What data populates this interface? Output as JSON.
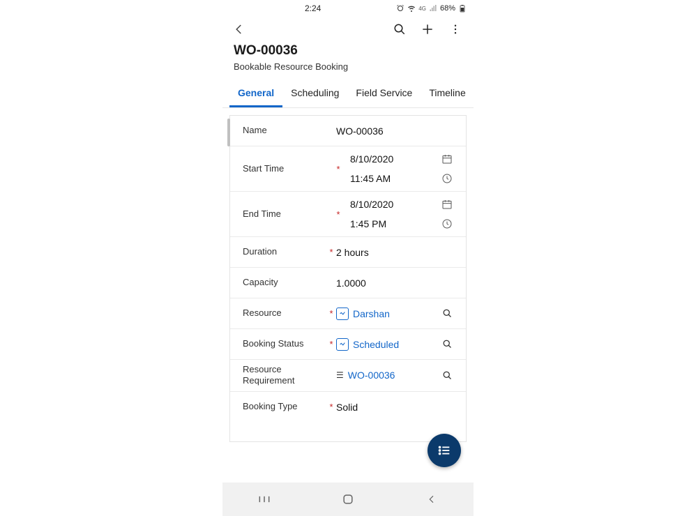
{
  "status": {
    "time": "2:24",
    "battery": "68%"
  },
  "header": {
    "title": "WO-00036",
    "subtitle": "Bookable Resource Booking"
  },
  "tabs": [
    {
      "label": "General",
      "active": true
    },
    {
      "label": "Scheduling",
      "active": false
    },
    {
      "label": "Field Service",
      "active": false
    },
    {
      "label": "Timeline",
      "active": false
    }
  ],
  "form": {
    "name": {
      "label": "Name",
      "value": "WO-00036",
      "required": false
    },
    "startTime": {
      "label": "Start Time",
      "date": "8/10/2020",
      "time": "11:45 AM",
      "required": true
    },
    "endTime": {
      "label": "End Time",
      "date": "8/10/2020",
      "time": "1:45 PM",
      "required": true
    },
    "duration": {
      "label": "Duration",
      "value": "2 hours",
      "required": true
    },
    "capacity": {
      "label": "Capacity",
      "value": "1.0000",
      "required": false
    },
    "resource": {
      "label": "Resource",
      "value": "Darshan",
      "required": true,
      "lookup": true
    },
    "bookingStatus": {
      "label": "Booking Status",
      "value": "Scheduled",
      "required": true,
      "lookup": true
    },
    "resourceReq": {
      "label": "Resource Requirement",
      "value": "WO-00036",
      "required": false,
      "lookup": true
    },
    "bookingType": {
      "label": "Booking Type",
      "value": "Solid",
      "required": true
    }
  }
}
